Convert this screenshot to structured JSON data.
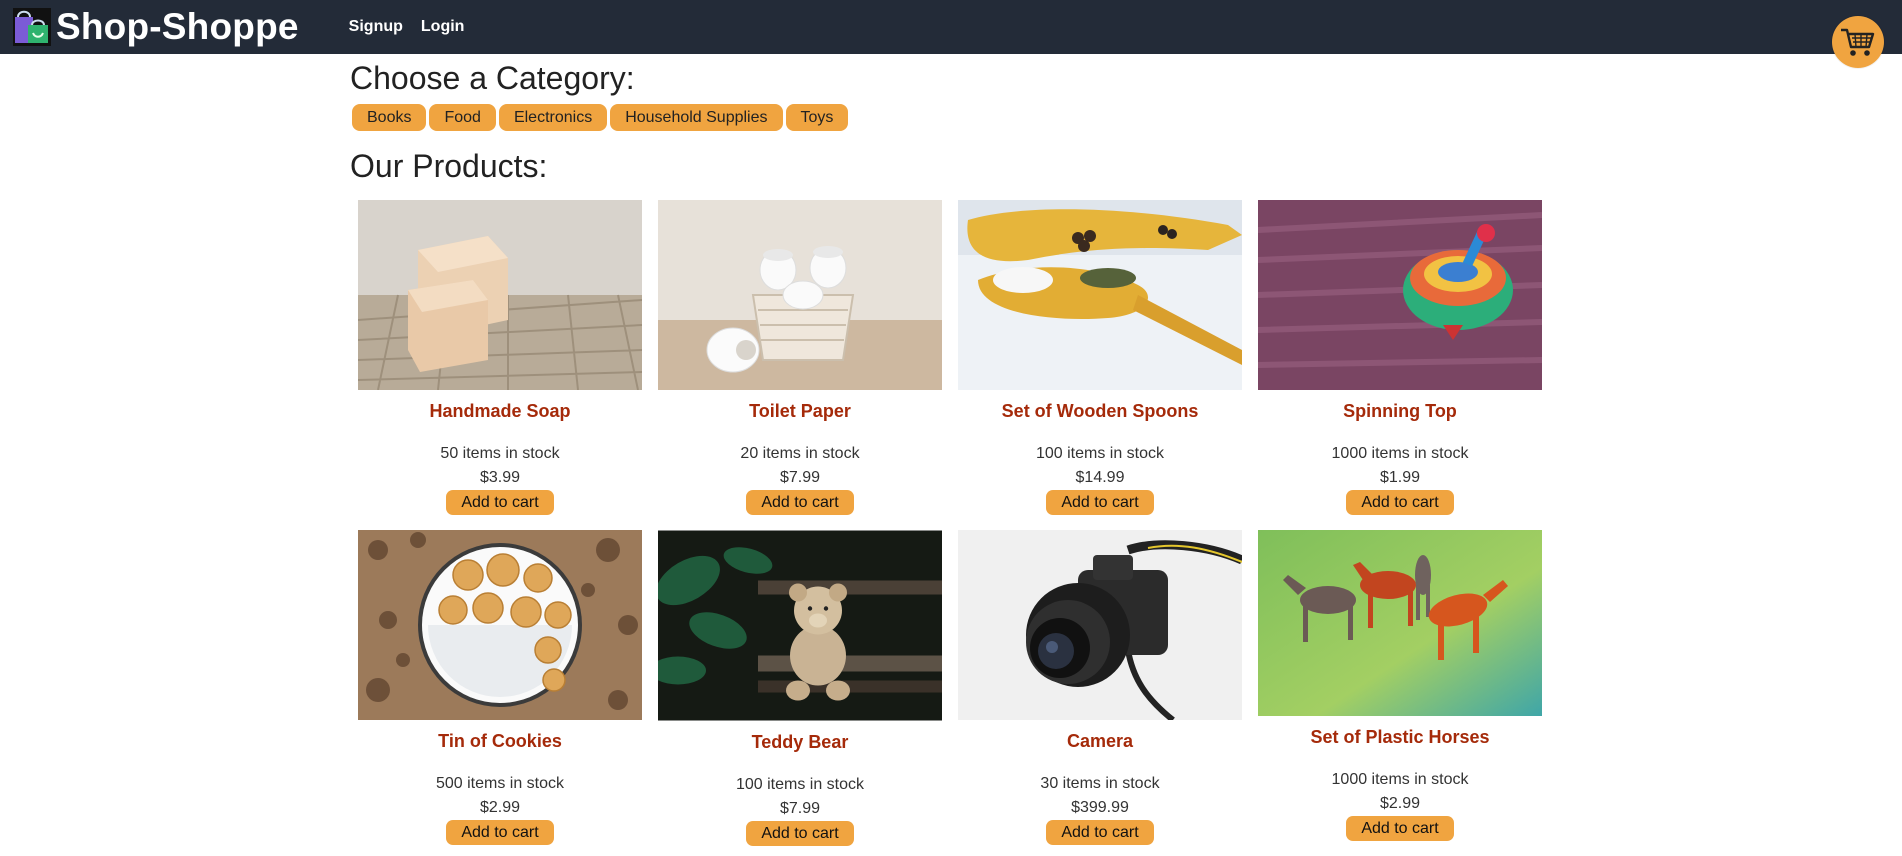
{
  "header": {
    "brand_title": "Shop-Shoppe",
    "nav": [
      {
        "label": "Signup"
      },
      {
        "label": "Login"
      }
    ]
  },
  "categories": {
    "title": "Choose a Category:",
    "items": [
      "Books",
      "Food",
      "Electronics",
      "Household Supplies",
      "Toys"
    ]
  },
  "products": {
    "title": "Our Products:",
    "items": [
      {
        "name": "Handmade Soap",
        "stock": "50 items in stock",
        "price": "$3.99",
        "button": "Add to cart",
        "image": "soap"
      },
      {
        "name": "Toilet Paper",
        "stock": "20 items in stock",
        "price": "$7.99",
        "button": "Add to cart",
        "image": "toilet-paper"
      },
      {
        "name": "Set of Wooden Spoons",
        "stock": "100 items in stock",
        "price": "$14.99",
        "button": "Add to cart",
        "image": "wooden-spoons"
      },
      {
        "name": "Spinning Top",
        "stock": "1000 items in stock",
        "price": "$1.99",
        "button": "Add to cart",
        "image": "spinning-top"
      },
      {
        "name": "Tin of Cookies",
        "stock": "500 items in stock",
        "price": "$2.99",
        "button": "Add to cart",
        "image": "cookies"
      },
      {
        "name": "Teddy Bear",
        "stock": "100 items in stock",
        "price": "$7.99",
        "button": "Add to cart",
        "image": "teddy-bear"
      },
      {
        "name": "Camera",
        "stock": "30 items in stock",
        "price": "$399.99",
        "button": "Add to cart",
        "image": "camera"
      },
      {
        "name": "Set of Plastic Horses",
        "stock": "1000 items in stock",
        "price": "$2.99",
        "button": "Add to cart",
        "image": "plastic-horses"
      }
    ]
  },
  "icons": {
    "logo": "shopping-bag-icon",
    "cart": "shopping-cart-icon"
  },
  "colors": {
    "navbar": "#232b38",
    "accent": "#f0a440",
    "product_name": "#a52a0a"
  }
}
